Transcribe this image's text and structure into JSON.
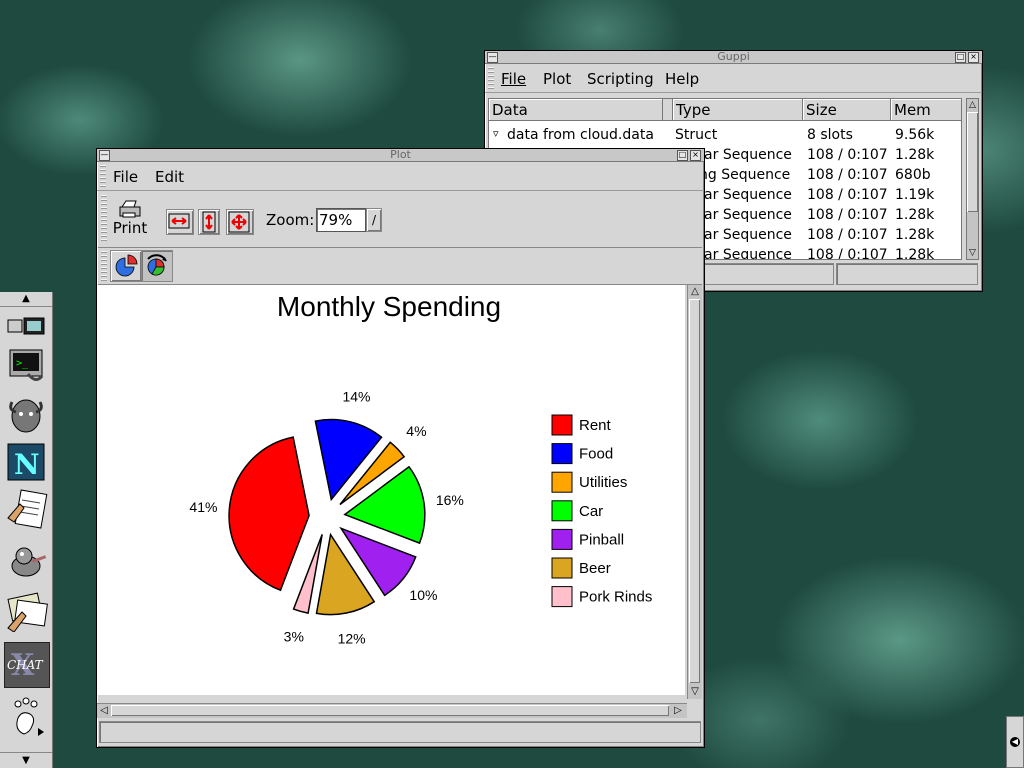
{
  "guppi": {
    "title": "Guppi",
    "menu": [
      {
        "label": "File",
        "mnemonic": "F"
      },
      {
        "label": "Plot"
      },
      {
        "label": "Scripting"
      },
      {
        "label": "Help",
        "mnemonic": "H"
      }
    ],
    "columns": [
      "Data",
      "Type",
      "Size",
      "Mem"
    ],
    "rows": [
      {
        "data": "data from cloud.data",
        "type": "Struct",
        "size": "8 slots",
        "mem": "9.56k"
      },
      {
        "data": "",
        "type": "Scalar Sequence",
        "size": "108 / 0:107",
        "mem": "1.28k"
      },
      {
        "data": "",
        "type": "String Sequence",
        "size": "108 / 0:107",
        "mem": "680b"
      },
      {
        "data": "",
        "type": "Scalar Sequence",
        "size": "108 / 0:107",
        "mem": "1.19k"
      },
      {
        "data": "",
        "type": "Scalar Sequence",
        "size": "108 / 0:107",
        "mem": "1.28k"
      },
      {
        "data": "",
        "type": "Scalar Sequence",
        "size": "108 / 0:107",
        "mem": "1.28k"
      },
      {
        "data": "",
        "type": "Scalar Sequence",
        "size": "108 / 0:107",
        "mem": "1.28k"
      }
    ]
  },
  "plot_window": {
    "title": "Plot",
    "menu": [
      {
        "label": "File",
        "mnemonic": "F"
      },
      {
        "label": "Edit",
        "mnemonic": "E"
      }
    ],
    "toolbar": {
      "print_label": "Print",
      "zoom_label": "Zoom:",
      "zoom_value": "79%"
    }
  },
  "chart_data": {
    "type": "pie",
    "title": "Monthly Spending",
    "exploded": true,
    "legend_position": "right",
    "slices": [
      {
        "name": "Rent",
        "value": 41,
        "label": "41%",
        "color": "#ff0000"
      },
      {
        "name": "Food",
        "value": 14,
        "label": "14%",
        "color": "#0000ff"
      },
      {
        "name": "Utilities",
        "value": 4,
        "label": "4%",
        "color": "#ffa500"
      },
      {
        "name": "Car",
        "value": 16,
        "label": "16%",
        "color": "#00ff00"
      },
      {
        "name": "Pinball",
        "value": 10,
        "label": "10%",
        "color": "#a020f0"
      },
      {
        "name": "Beer",
        "value": 12,
        "label": "12%",
        "color": "#daa520"
      },
      {
        "name": "Pork Rinds",
        "value": 3,
        "label": "3%",
        "color": "#ffc0cb"
      }
    ]
  },
  "panel": {
    "icons": [
      "monitor-icon",
      "terminal-icon",
      "gnu-icon",
      "netscape-icon",
      "text-editor-icon",
      "gimp-icon",
      "mail-icon",
      "xchat-icon",
      "gnome-foot-icon"
    ]
  }
}
